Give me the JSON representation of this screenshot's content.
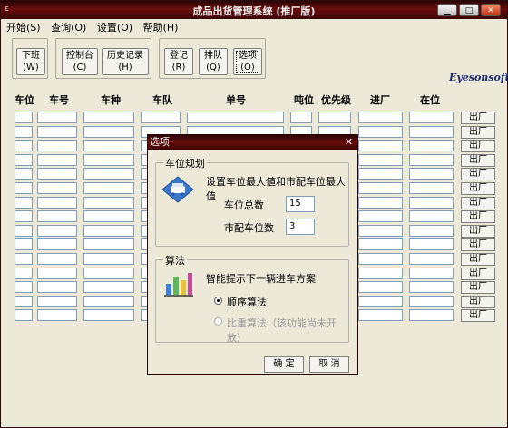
{
  "window": {
    "title": "成品出货管理系统 (推厂版)",
    "icon_text": "ε"
  },
  "menu": [
    {
      "label": "开始(S)"
    },
    {
      "label": "查询(O)"
    },
    {
      "label": "设置(O)"
    },
    {
      "label": "帮助(H)"
    }
  ],
  "toolbar": {
    "b1": {
      "label": "下班",
      "key": "(W)"
    },
    "b2": {
      "label": "控制台",
      "key": "(C)"
    },
    "b3": {
      "label": "历史记录",
      "key": "(H)"
    },
    "b4": {
      "label": "登记",
      "key": "(R)"
    },
    "b5": {
      "label": "排队",
      "key": "(Q)"
    },
    "b6": {
      "label": "选项",
      "key": "(O)"
    }
  },
  "brand": "Eyesonsoft",
  "columns": [
    "车位",
    "车号",
    "车种",
    "车队",
    "单号",
    "吨位",
    "优先级",
    "进厂",
    "在位"
  ],
  "out_label": "出厂",
  "dialog": {
    "title": "选项",
    "close": "✕",
    "parking": {
      "legend": "车位规划",
      "desc": "设置车位最大値和市配车位最大值",
      "total_label": "车位总数",
      "total_value": "15",
      "city_label": "市配车位数",
      "city_value": "3"
    },
    "algo": {
      "legend": "算法",
      "desc": "智能提示下一辆进车方案",
      "option1": "顺序算法",
      "option2": "比重算法（该功能尚未开放）"
    },
    "ok": "确 定",
    "cancel": "取 消"
  }
}
